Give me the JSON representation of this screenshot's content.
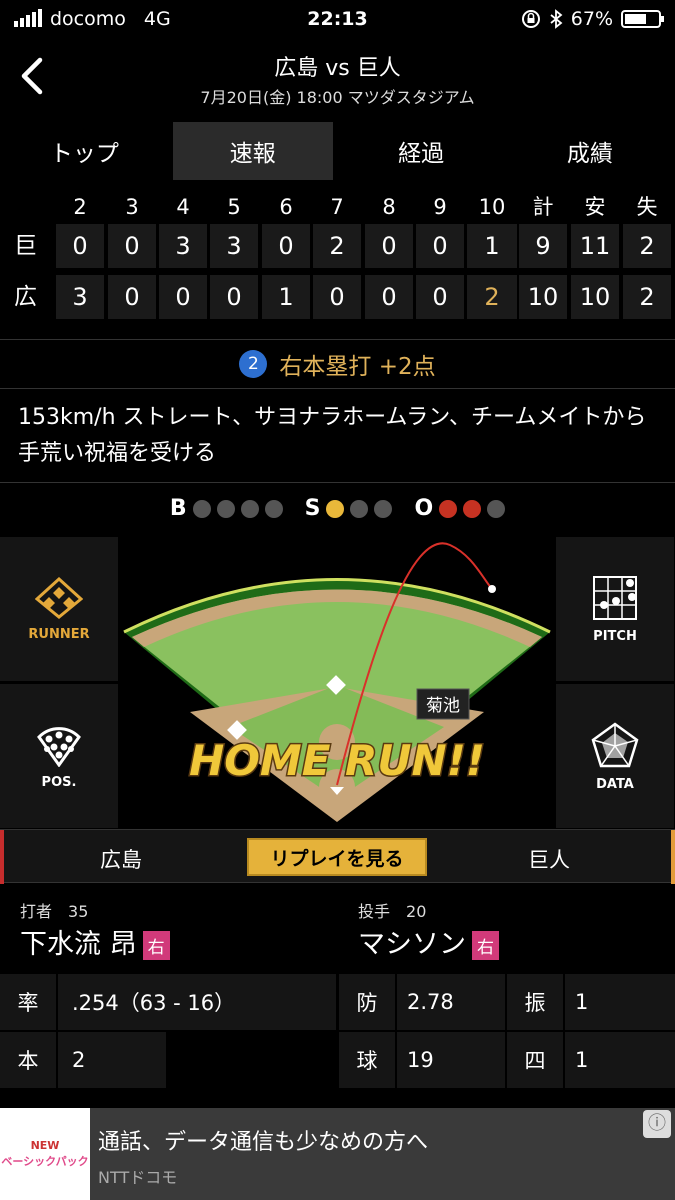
{
  "status": {
    "carrier": "docomo",
    "network": "4G",
    "time": "22:13",
    "battery": "67%"
  },
  "header": {
    "title": "広島 vs 巨人",
    "subtitle": "7月20日(金) 18:00 マツダスタジアム"
  },
  "tabs": [
    {
      "label": "トップ",
      "active": false
    },
    {
      "label": "速報",
      "active": true
    },
    {
      "label": "経過",
      "active": false
    },
    {
      "label": "成績",
      "active": false
    }
  ],
  "scoreboard": {
    "innings": [
      "2",
      "3",
      "4",
      "5",
      "6",
      "7",
      "8",
      "9",
      "10",
      "計",
      "安",
      "失"
    ],
    "rows": [
      {
        "team": "巨",
        "cells": [
          "0",
          "0",
          "3",
          "3",
          "0",
          "2",
          "0",
          "0",
          "1",
          "9",
          "11",
          "2"
        ]
      },
      {
        "team": "広",
        "cells": [
          "3",
          "0",
          "0",
          "0",
          "1",
          "0",
          "0",
          "0",
          "2",
          "10",
          "10",
          "2"
        ]
      }
    ],
    "highlight_color": "#e0b25a"
  },
  "play": {
    "number": "2",
    "text": "右本塁打 +2点"
  },
  "description": "153km/h ストレート、サヨナラホームラン、チームメイトから手荒い祝福を受ける",
  "bso": {
    "b_label": "B",
    "s_label": "S",
    "o_label": "O",
    "balls": 0,
    "strikes": 1,
    "outs": 2
  },
  "field": {
    "fielder_label": "菊池",
    "banner": "HOME RUN!!"
  },
  "side_buttons": {
    "runner": "RUNNER",
    "pos": "POS.",
    "pitch": "PITCH",
    "data": "DATA"
  },
  "teams": {
    "left": "広島",
    "right": "巨人",
    "replay": "リプレイを見る"
  },
  "batter": {
    "role": "打者",
    "number": "35",
    "name": "下水流 昂",
    "hand": "右",
    "stats": [
      {
        "k": "率",
        "v": ".254（63 - 16）"
      },
      {
        "k": "本",
        "v": "2"
      }
    ]
  },
  "pitcher": {
    "role": "投手",
    "number": "20",
    "name": "マシソン",
    "hand": "右",
    "stats": [
      {
        "k": "防",
        "v": "2.78"
      },
      {
        "k": "振",
        "v": "1"
      },
      {
        "k": "球",
        "v": "19"
      },
      {
        "k": "四",
        "v": "1"
      }
    ]
  },
  "ad": {
    "image_text": "ベーシックパック",
    "image_badge": "NEW",
    "title": "通話、データ通信も少なめの方へ",
    "source": "NTTドコモ"
  }
}
